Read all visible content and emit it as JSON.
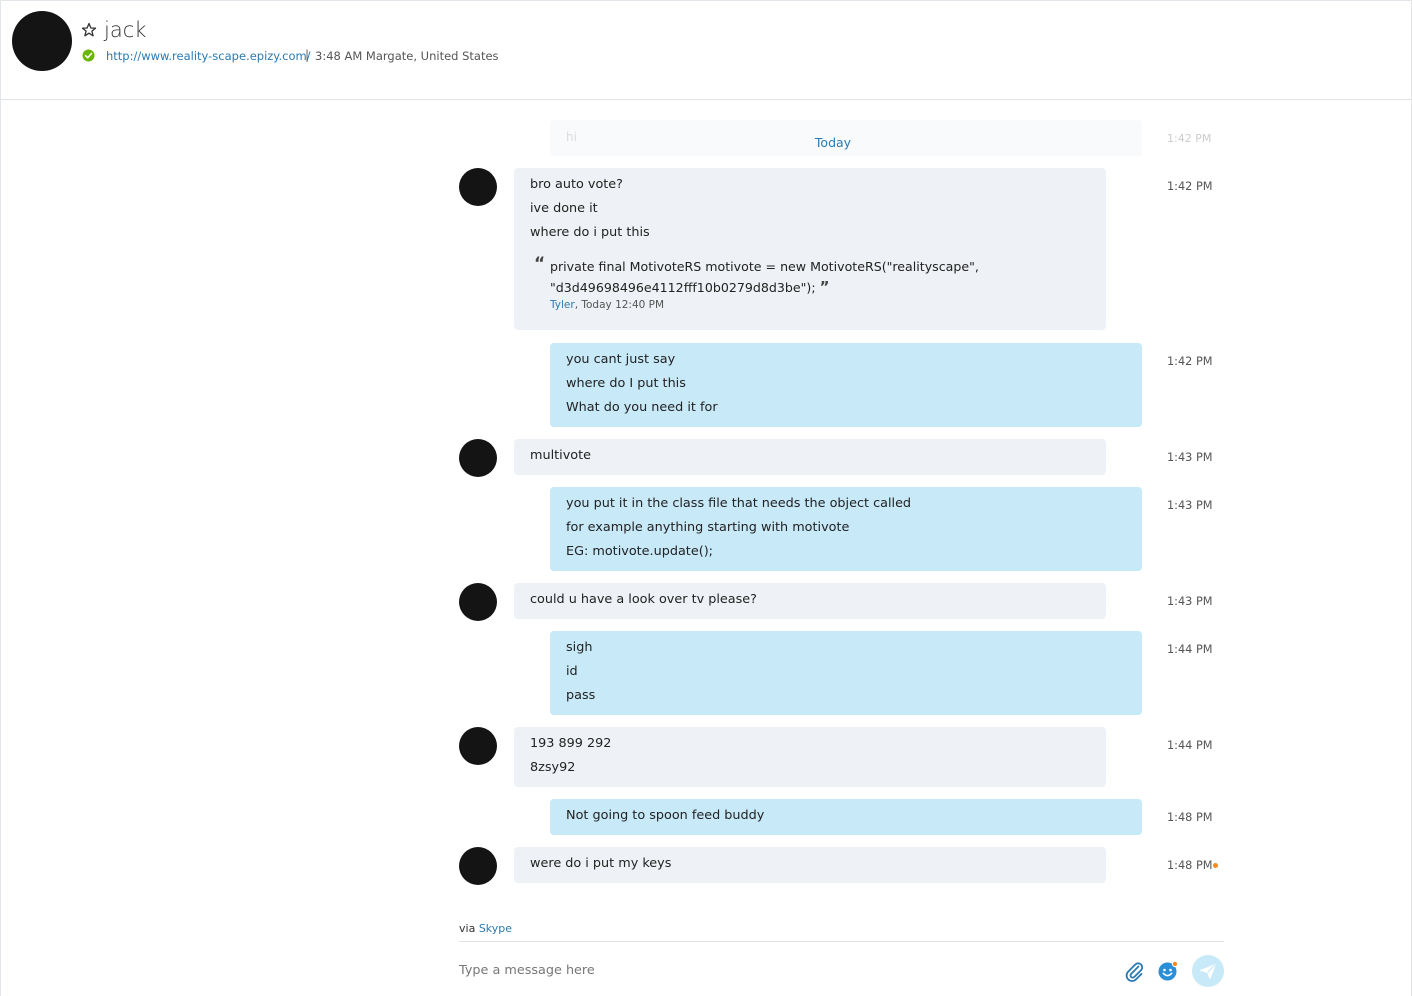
{
  "header": {
    "contact_name": "jack",
    "mood_link": "http://www.reality-scape.epizy.com/",
    "separator": "|",
    "local_time": "3:48 AM Margate, United States",
    "presence": "online"
  },
  "conversation": {
    "faded_message": "hi",
    "faded_time": "1:42 PM",
    "day_divider": "Today",
    "messages": [
      {
        "direction": "in",
        "lines": [
          "bro auto vote?",
          "ive done it",
          "where do i put this"
        ],
        "quote": {
          "line1": "private final MotivoteRS motivote = new MotivoteRS(\"realityscape\",",
          "line2": "\"d3d49698496e4112fff10b0279d8d3be\");",
          "author": "Tyler",
          "meta": ", Today 12:40 PM"
        },
        "time": "1:42 PM"
      },
      {
        "direction": "out",
        "lines": [
          "you cant just say",
          "where do I put this",
          "What do you need it for"
        ],
        "time": "1:42 PM"
      },
      {
        "direction": "in",
        "lines": [
          "multivote"
        ],
        "time": "1:43 PM"
      },
      {
        "direction": "out",
        "lines": [
          "you put it in the class file that needs the object called",
          "for example anything starting with motivote",
          "EG: motivote.update();"
        ],
        "time": "1:43 PM"
      },
      {
        "direction": "in",
        "lines": [
          "could u have a look over tv please?"
        ],
        "time": "1:43 PM"
      },
      {
        "direction": "out",
        "lines": [
          "sigh",
          "id",
          "pass"
        ],
        "time": "1:44 PM"
      },
      {
        "direction": "in",
        "lines": [
          "193 899 292",
          "8zsy92"
        ],
        "time": "1:44 PM"
      },
      {
        "direction": "out",
        "lines": [
          "Not going to spoon feed buddy"
        ],
        "time": "1:48 PM"
      },
      {
        "direction": "in",
        "lines": [
          "were do i put my keys"
        ],
        "time": "1:48 PM"
      }
    ]
  },
  "composer": {
    "via_prefix": "via ",
    "via_service": "Skype",
    "placeholder": "Type a message here"
  },
  "colors": {
    "accent": "#2a7ab3",
    "outgoing_bubble": "#c7e9f8",
    "incoming_bubble": "#eef1f5",
    "presence_online": "#6bb700",
    "unread_dot": "#f58a1f"
  }
}
